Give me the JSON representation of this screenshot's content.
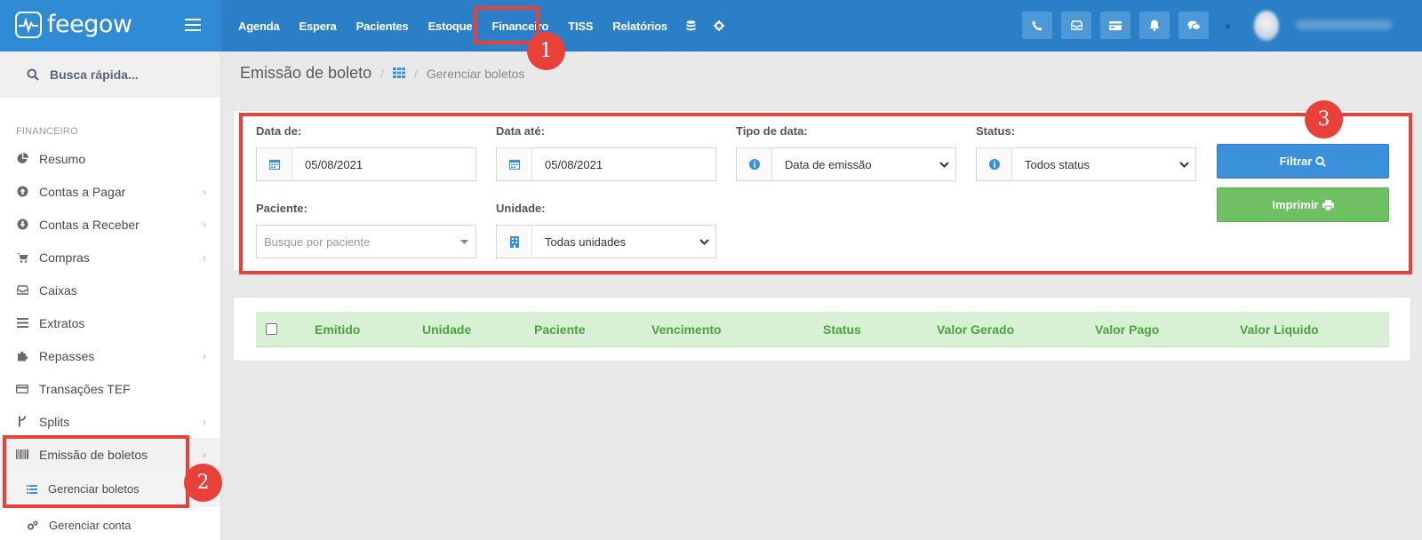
{
  "brand": {
    "name": "feegow"
  },
  "topnav": {
    "items": [
      "Agenda",
      "Espera",
      "Pacientes",
      "Estoque",
      "Financeiro",
      "TISS",
      "Relatórios"
    ],
    "icons": [
      "database-icon",
      "gear-icon"
    ],
    "actions": [
      "phone-icon",
      "inbox-icon",
      "card-icon",
      "bell-icon",
      "chat-icon"
    ]
  },
  "sidebar": {
    "search_label": "Busca rápida...",
    "section": "FINANCEIRO",
    "items": [
      {
        "label": "Resumo",
        "icon": "pie-chart-icon",
        "chevron": false
      },
      {
        "label": "Contas a Pagar",
        "icon": "arrow-up-circle-icon",
        "chevron": true
      },
      {
        "label": "Contas a Receber",
        "icon": "arrow-down-circle-icon",
        "chevron": true
      },
      {
        "label": "Compras",
        "icon": "cart-icon",
        "chevron": true
      },
      {
        "label": "Caixas",
        "icon": "inbox-icon",
        "chevron": false
      },
      {
        "label": "Extratos",
        "icon": "list-icon",
        "chevron": false
      },
      {
        "label": "Repasses",
        "icon": "puzzle-icon",
        "chevron": true
      },
      {
        "label": "Transações TEF",
        "icon": "credit-card-icon",
        "chevron": false
      },
      {
        "label": "Splits",
        "icon": "fork-icon",
        "chevron": true
      },
      {
        "label": "Emissão de boletos",
        "icon": "barcode-icon",
        "chevron": true
      }
    ],
    "subitems": [
      {
        "label": "Gerenciar boletos",
        "icon": "list-icon"
      },
      {
        "label": "Gerenciar conta",
        "icon": "cogs-icon"
      }
    ]
  },
  "breadcrumb": {
    "title": "Emissão de boleto",
    "link": "Gerenciar boletos"
  },
  "filters": {
    "data_de": {
      "label": "Data de:",
      "value": "05/08/2021"
    },
    "data_ate": {
      "label": "Data até:",
      "value": "05/08/2021"
    },
    "tipo_data": {
      "label": "Tipo de data:",
      "value": "Data de emissão"
    },
    "status": {
      "label": "Status:",
      "value": "Todos status"
    },
    "paciente": {
      "label": "Paciente:",
      "placeholder": "Busque por paciente"
    },
    "unidade": {
      "label": "Unidade:",
      "value": "Todas unidades"
    },
    "filtrar_label": "Filtrar",
    "imprimir_label": "Imprimir"
  },
  "table": {
    "columns": [
      "Emitido",
      "Unidade",
      "Paciente",
      "Vencimento",
      "Status",
      "Valor Gerado",
      "Valor Pago",
      "Valor Liquido"
    ]
  },
  "annotations": [
    "1",
    "2",
    "3"
  ],
  "colors": {
    "topbar": "#2a7fc6",
    "highlight": "#e8413a",
    "filter_button": "#3a90d9",
    "print_button": "#6ec062",
    "table_header": "#d8f0d4"
  }
}
